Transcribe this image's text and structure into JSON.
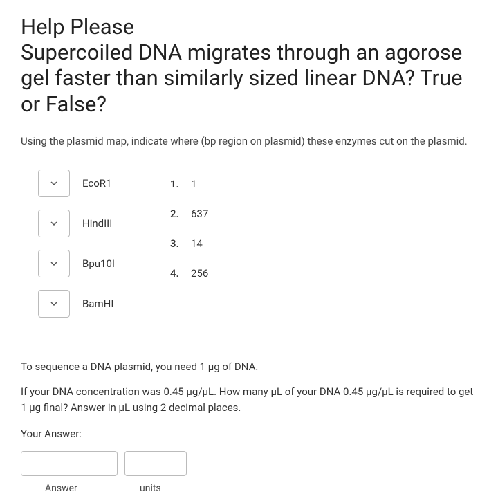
{
  "title": "Help Please\nSupercoiled DNA migrates through an agorose gel faster than similarly sized linear DNA? True or False?",
  "question_intro": "Using the plasmid map, indicate where (bp region on plasmid) these enzymes cut on the plasmid.",
  "enzymes": [
    {
      "name": "EcoR1"
    },
    {
      "name": "HindIII"
    },
    {
      "name": "Bpu10I"
    },
    {
      "name": "BamHI"
    }
  ],
  "options": [
    {
      "num": "1.",
      "value": "1"
    },
    {
      "num": "2.",
      "value": "637"
    },
    {
      "num": "3.",
      "value": "14"
    },
    {
      "num": "4.",
      "value": "256"
    }
  ],
  "sequence_q_line1": "To sequence a DNA plasmid, you need 1 µg of DNA.",
  "sequence_q_line2": "If your DNA concentration was 0.45 µg/µL. How many µL of your DNA 0.45 µg/µL is required to get 1 µg final? Answer in µL using 2 decimal places.",
  "your_answer_label": "Your Answer:",
  "answer_label": "Answer",
  "units_label": "units"
}
